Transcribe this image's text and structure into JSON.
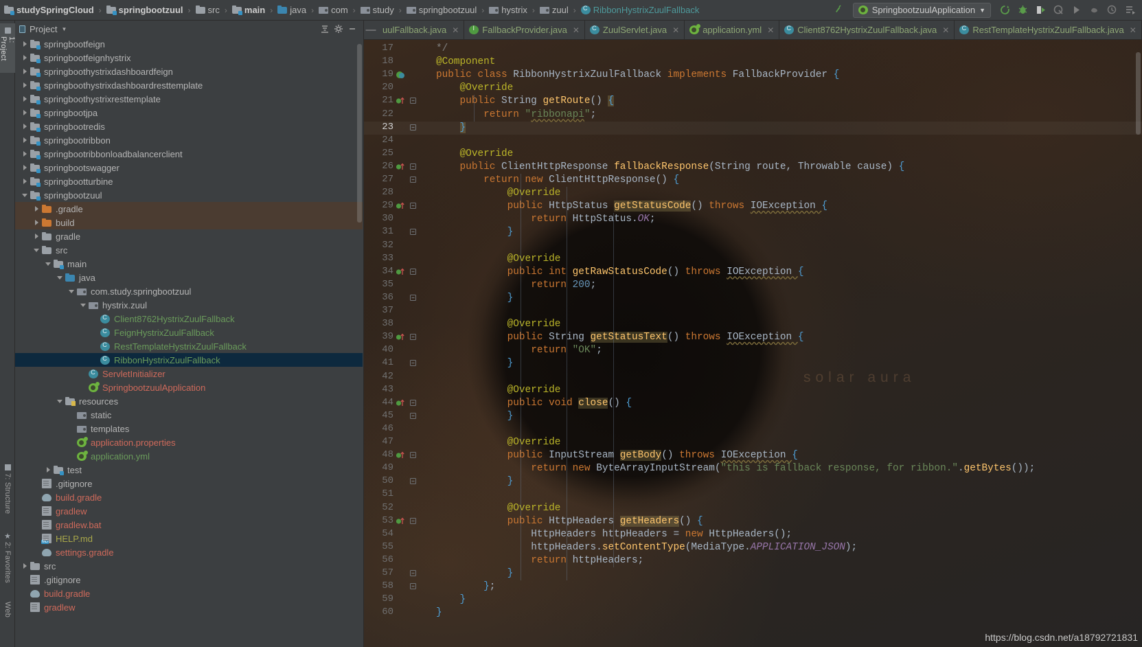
{
  "window": {
    "breadcrumb": [
      {
        "label": "studySpringCloud",
        "icon": "module-folder-icon",
        "style": "bold"
      },
      {
        "label": "springbootzuul",
        "icon": "module-folder-icon",
        "style": "bold"
      },
      {
        "label": "src",
        "icon": "folder-icon",
        "style": "plain"
      },
      {
        "label": "main",
        "icon": "module-folder-icon",
        "style": "bold"
      },
      {
        "label": "java",
        "icon": "source-folder-icon",
        "style": "plain"
      },
      {
        "label": "com",
        "icon": "package-icon",
        "style": "plain"
      },
      {
        "label": "study",
        "icon": "package-icon",
        "style": "plain"
      },
      {
        "label": "springbootzuul",
        "icon": "package-icon",
        "style": "plain"
      },
      {
        "label": "hystrix",
        "icon": "package-icon",
        "style": "plain"
      },
      {
        "label": "zuul",
        "icon": "package-icon",
        "style": "plain"
      },
      {
        "label": "RibbonHystrixZuulFallback",
        "icon": "class-icon",
        "style": "class"
      }
    ],
    "run_configuration": "SpringbootzuulApplication",
    "toolbar_icons": [
      "build-icon",
      "run-icon",
      "debug-icon",
      "run-with-coverage-icon",
      "profile-icon",
      "attach-icon",
      "stop-icon",
      "history-icon",
      "layout-icon"
    ]
  },
  "tool_strip": {
    "tabs": [
      {
        "label": "1: Project",
        "icon": "project-icon",
        "active": true
      },
      {
        "label": "7: Structure",
        "icon": "structure-icon",
        "active": false
      },
      {
        "label": "2: Favorites",
        "icon": "star-icon",
        "active": false
      },
      {
        "label": "Web",
        "icon": "web-icon",
        "active": false
      }
    ]
  },
  "project_panel": {
    "title": "Project",
    "header_icons": [
      "collapse-all-icon",
      "settings-gear-icon",
      "hide-icon"
    ],
    "tree": [
      {
        "depth": 1,
        "label": "springbootfeign",
        "icon": "module-folder-icon",
        "arrow": "right",
        "color": "c-gray"
      },
      {
        "depth": 1,
        "label": "springbootfeignhystrix",
        "icon": "module-folder-icon",
        "arrow": "right",
        "color": "c-gray"
      },
      {
        "depth": 1,
        "label": "springboothystrixdashboardfeign",
        "icon": "module-folder-icon",
        "arrow": "right",
        "color": "c-gray"
      },
      {
        "depth": 1,
        "label": "springboothystrixdashboardresttemplate",
        "icon": "module-folder-icon",
        "arrow": "right",
        "color": "c-gray"
      },
      {
        "depth": 1,
        "label": "springboothystrixresttemplate",
        "icon": "module-folder-icon",
        "arrow": "right",
        "color": "c-gray"
      },
      {
        "depth": 1,
        "label": "springbootjpa",
        "icon": "module-folder-icon",
        "arrow": "right",
        "color": "c-gray"
      },
      {
        "depth": 1,
        "label": "springbootredis",
        "icon": "module-folder-icon",
        "arrow": "right",
        "color": "c-gray"
      },
      {
        "depth": 1,
        "label": "springbootribbon",
        "icon": "module-folder-icon",
        "arrow": "right",
        "color": "c-gray"
      },
      {
        "depth": 1,
        "label": "springbootribbonloadbalancerclient",
        "icon": "module-folder-icon",
        "arrow": "right",
        "color": "c-gray"
      },
      {
        "depth": 1,
        "label": "springbootswagger",
        "icon": "module-folder-icon",
        "arrow": "right",
        "color": "c-gray"
      },
      {
        "depth": 1,
        "label": "springbootturbine",
        "icon": "module-folder-icon",
        "arrow": "right",
        "color": "c-gray"
      },
      {
        "depth": 1,
        "label": "springbootzuul",
        "icon": "module-folder-icon",
        "arrow": "down",
        "color": "c-gray"
      },
      {
        "depth": 2,
        "label": ".gradle",
        "icon": "excluded-folder-icon",
        "arrow": "right",
        "color": "c-gray",
        "state": "excluded"
      },
      {
        "depth": 2,
        "label": "build",
        "icon": "excluded-folder-icon",
        "arrow": "right",
        "color": "c-gray",
        "state": "excluded"
      },
      {
        "depth": 2,
        "label": "gradle",
        "icon": "folder-icon",
        "arrow": "right",
        "color": "c-gray"
      },
      {
        "depth": 2,
        "label": "src",
        "icon": "folder-icon",
        "arrow": "down",
        "color": "c-gray"
      },
      {
        "depth": 3,
        "label": "main",
        "icon": "module-folder-icon",
        "arrow": "down",
        "color": "c-gray"
      },
      {
        "depth": 4,
        "label": "java",
        "icon": "source-folder-icon",
        "arrow": "down",
        "color": "c-gray"
      },
      {
        "depth": 5,
        "label": "com.study.springbootzuul",
        "icon": "package-icon",
        "arrow": "down",
        "color": "c-gray"
      },
      {
        "depth": 6,
        "label": "hystrix.zuul",
        "icon": "package-icon",
        "arrow": "down",
        "color": "c-gray"
      },
      {
        "depth": 7,
        "label": "Client8762HystrixZuulFallback",
        "icon": "class-icon",
        "arrow": "none",
        "color": "c-green"
      },
      {
        "depth": 7,
        "label": "FeignHystrixZuulFallback",
        "icon": "class-icon",
        "arrow": "none",
        "color": "c-green"
      },
      {
        "depth": 7,
        "label": "RestTemplateHystrixZuulFallback",
        "icon": "class-icon",
        "arrow": "none",
        "color": "c-green"
      },
      {
        "depth": 7,
        "label": "RibbonHystrixZuulFallback",
        "icon": "class-icon",
        "arrow": "none",
        "color": "c-green",
        "state": "selected"
      },
      {
        "depth": 6,
        "label": "ServletInitializer",
        "icon": "class-icon",
        "arrow": "none",
        "color": "c-salmon"
      },
      {
        "depth": 6,
        "label": "SpringbootzuulApplication",
        "icon": "spring-class-icon",
        "arrow": "none",
        "color": "c-salmon"
      },
      {
        "depth": 4,
        "label": "resources",
        "icon": "resource-folder-icon",
        "arrow": "down",
        "color": "c-gray"
      },
      {
        "depth": 5,
        "label": "static",
        "icon": "package-icon",
        "arrow": "none",
        "color": "c-gray"
      },
      {
        "depth": 5,
        "label": "templates",
        "icon": "package-icon",
        "arrow": "none",
        "color": "c-gray"
      },
      {
        "depth": 5,
        "label": "application.properties",
        "icon": "spring-config-icon",
        "arrow": "none",
        "color": "c-salmon"
      },
      {
        "depth": 5,
        "label": "application.yml",
        "icon": "spring-config-icon",
        "arrow": "none",
        "color": "c-green"
      },
      {
        "depth": 3,
        "label": "test",
        "icon": "module-folder-icon",
        "arrow": "right",
        "color": "c-gray"
      },
      {
        "depth": 2,
        "label": ".gitignore",
        "icon": "text-file-icon",
        "arrow": "none",
        "color": "c-gray"
      },
      {
        "depth": 2,
        "label": "build.gradle",
        "icon": "gradle-file-icon",
        "arrow": "none",
        "color": "c-salmon"
      },
      {
        "depth": 2,
        "label": "gradlew",
        "icon": "text-file-icon",
        "arrow": "none",
        "color": "c-salmon"
      },
      {
        "depth": 2,
        "label": "gradlew.bat",
        "icon": "text-file-icon",
        "arrow": "none",
        "color": "c-salmon"
      },
      {
        "depth": 2,
        "label": "HELP.md",
        "icon": "markdown-file-icon",
        "arrow": "none",
        "color": "c-yellow"
      },
      {
        "depth": 2,
        "label": "settings.gradle",
        "icon": "gradle-file-icon",
        "arrow": "none",
        "color": "c-salmon"
      },
      {
        "depth": 1,
        "label": "src",
        "icon": "folder-icon",
        "arrow": "right",
        "color": "c-gray"
      },
      {
        "depth": 1,
        "label": ".gitignore",
        "icon": "text-file-icon",
        "arrow": "none",
        "color": "c-gray"
      },
      {
        "depth": 1,
        "label": "build.gradle",
        "icon": "gradle-file-icon",
        "arrow": "none",
        "color": "c-salmon"
      },
      {
        "depth": 1,
        "label": "gradlew",
        "icon": "text-file-icon",
        "arrow": "none",
        "color": "c-salmon"
      }
    ]
  },
  "editor": {
    "tabs": [
      {
        "label": "uulFallback.java",
        "icon": "class-icon",
        "active": false,
        "truncated": true
      },
      {
        "label": "FallbackProvider.java",
        "icon": "interface-icon",
        "active": false
      },
      {
        "label": "ZuulServlet.java",
        "icon": "class-icon",
        "active": false
      },
      {
        "label": "application.yml",
        "icon": "spring-config-icon",
        "active": false
      },
      {
        "label": "Client8762HystrixZuulFallback.java",
        "icon": "class-icon",
        "active": false
      },
      {
        "label": "RestTemplateHystrixZuulFallback.java",
        "icon": "class-icon",
        "active": false
      }
    ],
    "current_line": 23,
    "first_line": 17,
    "last_line": 60,
    "code_lines": [
      {
        "n": 17,
        "indent": 0,
        "html": "<span class=\"cmt\">*/</span>"
      },
      {
        "n": 18,
        "indent": 0,
        "html": "<span class=\"ann\">@Component</span>"
      },
      {
        "n": 19,
        "indent": 0,
        "gutter": "override-impl-icon",
        "html": "<span class=\"kw\">public class </span><span class=\"cls2\">RibbonHystrixZuulFallback </span><span class=\"kw\">implements </span><span class=\"cls2\">FallbackProvider </span><span class=\"brace\">{</span>"
      },
      {
        "n": 20,
        "indent": 1,
        "html": "    <span class=\"ann\">@Override</span>"
      },
      {
        "n": 21,
        "indent": 1,
        "gutter": "override-method-icon",
        "fold": true,
        "html": "    <span class=\"kw\">public </span><span class=\"cls2\">String </span><span class=\"mth\">getRoute</span><span class=\"type\">() </span><span class=\"brace hl\">{</span>"
      },
      {
        "n": 22,
        "indent": 2,
        "html": "        <span class=\"kw\">return </span><span class=\"str\">\"</span><span class=\"str err\">ribbonapi</span><span class=\"str\">\"</span><span class=\"type\">;</span>"
      },
      {
        "n": 23,
        "indent": 1,
        "current": true,
        "fold": true,
        "html": "    <span class=\"brace hl\">}</span>"
      },
      {
        "n": 24,
        "indent": 1,
        "html": ""
      },
      {
        "n": 25,
        "indent": 1,
        "html": "    <span class=\"ann\">@Override</span>"
      },
      {
        "n": 26,
        "indent": 1,
        "gutter": "override-method-icon",
        "fold": true,
        "html": "    <span class=\"kw\">public </span><span class=\"cls2\">ClientHttpResponse </span><span class=\"mth\">fallbackResponse</span><span class=\"type\">(</span><span class=\"cls2\">String </span><span class=\"type\">route, </span><span class=\"cls2\">Throwable </span><span class=\"type\">cause) </span><span class=\"brace\">{</span>"
      },
      {
        "n": 27,
        "indent": 2,
        "fold": true,
        "html": "        <span class=\"kw\">return new </span><span class=\"cls2\">ClientHttpResponse</span><span class=\"type\">() </span><span class=\"brace\">{</span>"
      },
      {
        "n": 28,
        "indent": 3,
        "html": "            <span class=\"ann\">@Override</span>"
      },
      {
        "n": 29,
        "indent": 3,
        "gutter": "override-method-icon",
        "fold": true,
        "html": "            <span class=\"kw\">public </span><span class=\"cls2\">HttpStatus </span><span class=\"mth hl\">getStatusCode</span><span class=\"type\">() </span><span class=\"kw\">throws </span><span class=\"cls2 err\">IOException </span><span class=\"brace\">{</span>"
      },
      {
        "n": 30,
        "indent": 4,
        "html": "                <span class=\"kw\">return </span><span class=\"cls2\">HttpStatus.</span><span class=\"stat\">OK</span><span class=\"type\">;</span>"
      },
      {
        "n": 31,
        "indent": 3,
        "fold": true,
        "html": "            <span class=\"brace\">}</span>"
      },
      {
        "n": 32,
        "indent": 3,
        "html": ""
      },
      {
        "n": 33,
        "indent": 3,
        "html": "            <span class=\"ann\">@Override</span>"
      },
      {
        "n": 34,
        "indent": 3,
        "gutter": "override-method-icon",
        "fold": true,
        "html": "            <span class=\"kw\">public int </span><span class=\"mth\">getRawStatusCode</span><span class=\"type\">() </span><span class=\"kw\">throws </span><span class=\"cls2 err\">IOException </span><span class=\"brace\">{</span>"
      },
      {
        "n": 35,
        "indent": 4,
        "html": "                <span class=\"kw\">return </span><span class=\"num\">200</span><span class=\"type\">;</span>"
      },
      {
        "n": 36,
        "indent": 3,
        "fold": true,
        "html": "            <span class=\"brace\">}</span>"
      },
      {
        "n": 37,
        "indent": 3,
        "html": ""
      },
      {
        "n": 38,
        "indent": 3,
        "html": "            <span class=\"ann\">@Override</span>"
      },
      {
        "n": 39,
        "indent": 3,
        "gutter": "override-method-icon",
        "fold": true,
        "html": "            <span class=\"kw\">public </span><span class=\"cls2\">String </span><span class=\"mth hl\">getStatusText</span><span class=\"type\">() </span><span class=\"kw\">throws </span><span class=\"cls2 err\">IOException </span><span class=\"brace\">{</span>"
      },
      {
        "n": 40,
        "indent": 4,
        "html": "                <span class=\"kw\">return </span><span class=\"str\">\"OK\"</span><span class=\"type\">;</span>"
      },
      {
        "n": 41,
        "indent": 3,
        "fold": true,
        "html": "            <span class=\"brace\">}</span>"
      },
      {
        "n": 42,
        "indent": 3,
        "html": ""
      },
      {
        "n": 43,
        "indent": 3,
        "html": "            <span class=\"ann\">@Override</span>"
      },
      {
        "n": 44,
        "indent": 3,
        "gutter": "override-method-icon",
        "fold": true,
        "html": "            <span class=\"kw\">public void </span><span class=\"mth hl\">close</span><span class=\"type\">() </span><span class=\"brace\">{</span>"
      },
      {
        "n": 45,
        "indent": 3,
        "fold": true,
        "html": "            <span class=\"brace\">}</span>"
      },
      {
        "n": 46,
        "indent": 3,
        "html": ""
      },
      {
        "n": 47,
        "indent": 3,
        "html": "            <span class=\"ann\">@Override</span>"
      },
      {
        "n": 48,
        "indent": 3,
        "gutter": "override-method-icon",
        "fold": true,
        "html": "            <span class=\"kw\">public </span><span class=\"cls2\">InputStream </span><span class=\"mth hl\">getBody</span><span class=\"type\">() </span><span class=\"kw\">throws </span><span class=\"cls2 err\">IOException </span><span class=\"brace\">{</span>"
      },
      {
        "n": 49,
        "indent": 4,
        "html": "                <span class=\"kw\">return new </span><span class=\"cls2\">ByteArrayInputStream</span><span class=\"type\">(</span><span class=\"str\">\"this is fallback response, for ribbon.\"</span><span class=\"type\">.</span><span class=\"mth\">getBytes</span><span class=\"type\">());</span>"
      },
      {
        "n": 50,
        "indent": 3,
        "fold": true,
        "html": "            <span class=\"brace\">}</span>"
      },
      {
        "n": 51,
        "indent": 3,
        "html": ""
      },
      {
        "n": 52,
        "indent": 3,
        "html": "            <span class=\"ann\">@Override</span>"
      },
      {
        "n": 53,
        "indent": 3,
        "gutter": "override-method-icon",
        "fold": true,
        "html": "            <span class=\"kw\">public </span><span class=\"cls2\">HttpHeaders </span><span class=\"mth hl\">getHeaders</span><span class=\"type\">() </span><span class=\"brace\">{</span>"
      },
      {
        "n": 54,
        "indent": 4,
        "html": "                <span class=\"cls2\">HttpHeaders </span><span class=\"type\">httpHeaders = </span><span class=\"kw\">new </span><span class=\"cls2\">HttpHeaders</span><span class=\"type\">();</span>"
      },
      {
        "n": 55,
        "indent": 4,
        "html": "                <span class=\"type\">httpHeaders.</span><span class=\"mth\">setContentType</span><span class=\"type\">(</span><span class=\"cls2\">MediaType.</span><span class=\"stat\">APPLICATION_JSON</span><span class=\"type\">);</span>"
      },
      {
        "n": 56,
        "indent": 4,
        "html": "                <span class=\"kw\">return </span><span class=\"type\">httpHeaders;</span>"
      },
      {
        "n": 57,
        "indent": 3,
        "fold": true,
        "html": "            <span class=\"brace\">}</span>"
      },
      {
        "n": 58,
        "indent": 2,
        "fold": true,
        "html": "        <span class=\"brace\">}</span><span class=\"type\">;</span>"
      },
      {
        "n": 59,
        "indent": 1,
        "html": "    <span class=\"brace\">}</span>"
      },
      {
        "n": 60,
        "indent": 0,
        "html": "<span class=\"brace\">}</span>"
      }
    ],
    "background_watermark": "solar aura"
  },
  "footer": {
    "source_watermark": "https://blog.csdn.net/a18792721831"
  },
  "colors": {
    "chrome": "#3c3f41",
    "editor_bg": "#2b2b2b",
    "selection": "#0d293e",
    "excluded": "#4b3c31",
    "accent_green": "#6a9b5b",
    "accent_blue": "#3592c4",
    "keyword": "#cc7832",
    "string": "#6a8759",
    "method": "#ffc66d",
    "annotation": "#bbb529"
  }
}
